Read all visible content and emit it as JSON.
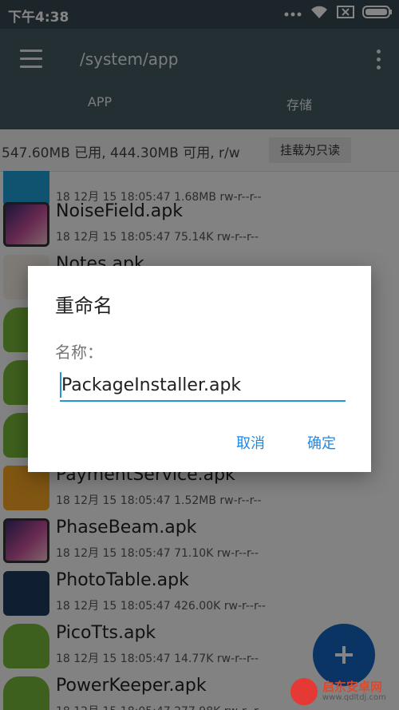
{
  "statusbar": {
    "time": "下午4:38",
    "icons": [
      "signal-icon",
      "wifi-icon",
      "sim-off-icon",
      "battery-icon"
    ]
  },
  "appbar": {
    "path": "/system/app",
    "tabs": [
      "APP",
      "存储"
    ]
  },
  "storage": {
    "summary": "547.60MB 已用, 444.30MB 可用, r/w",
    "mount_button": "挂载为只读"
  },
  "files": [
    {
      "name": "",
      "meta": "18 12月 15 18:05:47  1.68MB  rw-r--r--",
      "icon": "app-icon-blue"
    },
    {
      "name": "NoiseField.apk",
      "meta": "18 12月 15 18:05:47  75.14K  rw-r--r--",
      "icon": "wallpaper-icon"
    },
    {
      "name": "Notes.apk",
      "meta": "",
      "icon": "notes-icon"
    },
    {
      "name": "",
      "meta": "",
      "icon": "android-icon"
    },
    {
      "name": "",
      "meta": "",
      "icon": "android-icon"
    },
    {
      "name": "",
      "meta": "",
      "icon": "android-icon"
    },
    {
      "name": "PaymentService.apk",
      "meta": "18 12月 15 18:05:47  1.52MB  rw-r--r--",
      "icon": "mi-icon"
    },
    {
      "name": "PhaseBeam.apk",
      "meta": "18 12月 15 18:05:47  71.10K  rw-r--r--",
      "icon": "wallpaper-icon"
    },
    {
      "name": "PhotoTable.apk",
      "meta": "18 12月 15 18:05:47  426.00K  rw-r--r--",
      "icon": "phototable-icon"
    },
    {
      "name": "PicoTts.apk",
      "meta": "18 12月 15 18:05:47  14.77K  rw-r--r--",
      "icon": "android-icon"
    },
    {
      "name": "PowerKeeper.apk",
      "meta": "18 12月 15 18:05:47  277.98K  rw-r--r--",
      "icon": "android-icon"
    }
  ],
  "dialog": {
    "title": "重命名",
    "label": "名称：",
    "input_value": "PackageInstaller.apk",
    "cancel": "取消",
    "ok": "确定"
  },
  "fab": {
    "icon": "plus-icon"
  },
  "watermark": {
    "brand": "启东安卓网",
    "url": "www.qdltdj.com"
  },
  "colors": {
    "appbar": "#455a64",
    "statusbar": "#37474f",
    "accent": "#1e88e5",
    "fab": "#1565c0"
  }
}
